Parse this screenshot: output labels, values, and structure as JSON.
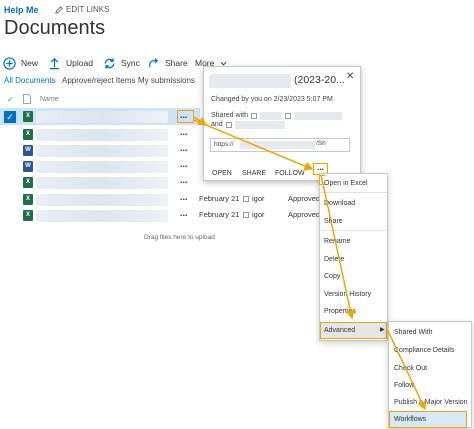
{
  "top_links": {
    "help": "Help Me",
    "edit_links": "EDIT LINKS"
  },
  "page_title": "Documents",
  "toolbar": {
    "new": "New",
    "upload": "Upload",
    "sync": "Sync",
    "share": "Share",
    "more": "More"
  },
  "views": {
    "all": "All Documents",
    "approve": "Approve/reject Items",
    "my_submissions": "My submissions"
  },
  "list": {
    "header_name": "Name",
    "header_check": "✓",
    "rows": [
      {
        "icon": "X",
        "type": "xls",
        "date": "",
        "person": "",
        "status": ""
      },
      {
        "icon": "X",
        "type": "xls",
        "date": "",
        "person": "",
        "status": ""
      },
      {
        "icon": "W",
        "type": "doc",
        "date": "",
        "person": "",
        "status": ""
      },
      {
        "icon": "W",
        "type": "doc",
        "date": "",
        "person": "",
        "status": ""
      },
      {
        "icon": "X",
        "type": "xls",
        "date": "February 21",
        "person": "igor",
        "status": "Approved"
      },
      {
        "icon": "X",
        "type": "xls",
        "date": "February 21",
        "person": "igor",
        "status": "Approved"
      }
    ],
    "more_glyph": "...",
    "selected_check": "✓",
    "drag_hint": "Drag files here to upload"
  },
  "callout": {
    "title_suffix": "(2023-20...",
    "close": "✕",
    "changed": "Changed by you on 2/23/2023 5:07 PM",
    "shared_with": "Shared with",
    "and": "and",
    "url_prefix": "https://",
    "url_suffix": "/Sh",
    "actions": {
      "open": "OPEN",
      "share": "SHARE",
      "follow": "FOLLOW"
    },
    "more_glyph": "..."
  },
  "context_menu": {
    "items": [
      "Open in Excel",
      "Download",
      "Share",
      "Rename",
      "Delete",
      "Copy",
      "Version History",
      "Properties"
    ],
    "advanced": "Advanced",
    "advanced_arrow": "▶"
  },
  "submenu": {
    "items": [
      "Shared With",
      "Compliance Details",
      "Check Out",
      "Follow",
      "Publish a Major Version",
      "Workflows"
    ]
  },
  "colors": {
    "accent": "#0072c6",
    "highlight": "#f0a500",
    "selected_row": "#cce4f7",
    "excel": "#1e7145",
    "word": "#2b579a"
  }
}
